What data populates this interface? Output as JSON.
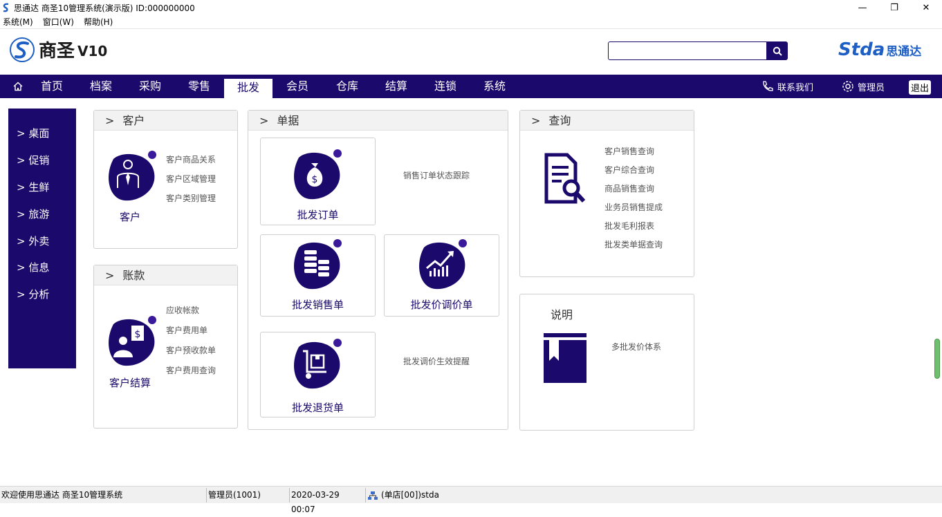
{
  "window": {
    "title": "思通达 商圣10管理系统(演示版) ID:000000000",
    "minimize": "—",
    "maximize": "❐",
    "close": "✕"
  },
  "menu": [
    "系统(M)",
    "窗口(W)",
    "帮助(H)"
  ],
  "brand": {
    "name": "商圣",
    "version": "V10",
    "company_en": "Stda",
    "company_cn": "思通达"
  },
  "search": {
    "value": "",
    "placeholder": ""
  },
  "nav": {
    "items": [
      "首页",
      "档案",
      "采购",
      "零售",
      "批发",
      "会员",
      "仓库",
      "结算",
      "连锁",
      "系统"
    ],
    "active": "批发",
    "contact": "联系我们",
    "user": "管理员",
    "logout": "退出"
  },
  "sidebar": [
    "> 桌面",
    "> 促销",
    "> 生鲜",
    "> 旅游",
    "> 外卖",
    "> 信息",
    "> 分析"
  ],
  "panels": {
    "customer": {
      "title": "客户",
      "icon_label": "客户",
      "links": [
        "客户商品关系",
        "客户区域管理",
        "客户类别管理"
      ]
    },
    "account": {
      "title": "账款",
      "icon_label": "客户结算",
      "links": [
        "应收帐款",
        "客户费用单",
        "客户预收款单",
        "客户费用查询"
      ]
    },
    "docs": {
      "title": "单据",
      "cards": [
        "批发订单",
        "批发销售单",
        "批发价调价单",
        "批发退货单"
      ],
      "links": [
        "销售订单状态跟踪",
        "批发调价生效提醒"
      ]
    },
    "query": {
      "title": "查询",
      "links": [
        "客户销售查询",
        "客户综合查询",
        "商品销售查询",
        "业务员销售提成",
        "批发毛利报表",
        "批发类单据查询"
      ]
    },
    "notes": {
      "title": "说明",
      "links": [
        "多批发价体系"
      ]
    }
  },
  "status": {
    "welcome": "欢迎使用思通达 商圣10管理系统",
    "user": "管理员(1001)",
    "datetime": "2020-03-29 00:07",
    "store": "(单店[00])stda"
  },
  "colors": {
    "primary": "#1b0a6b",
    "accent_dot": "#3a1a9a",
    "brand_blue": "#1d5fc5"
  }
}
